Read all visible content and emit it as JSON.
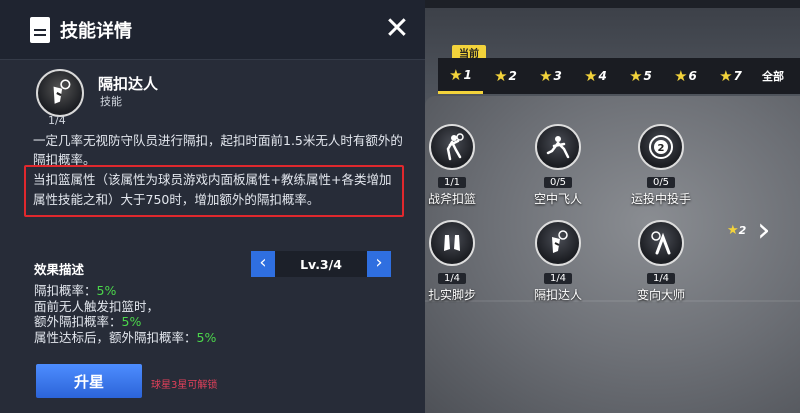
{
  "panel": {
    "title": "技能详情",
    "close_label": "✕",
    "skill": {
      "name": "隔扣达人",
      "type": "技能",
      "count": "1/4"
    },
    "description_1": "一定几率无视防守队员进行隔扣，起扣时面前1.5米无人时有额外的隔扣概率。",
    "description_2": "当扣篮属性（该属性为球员游戏内面板属性+教练属性+各类增加属性技能之和）大于750时，增加额外的隔扣概率。",
    "effect_label": "效果描述",
    "level": {
      "text": "Lv.3/4",
      "prev": "‹",
      "next": "›"
    },
    "effects": [
      {
        "label": "隔扣概率：",
        "value": "5%"
      },
      {
        "label": "面前无人触发扣篮时，",
        "value": ""
      },
      {
        "label": "额外隔扣概率：",
        "value": "5%"
      },
      {
        "label": "属性达标后，额外隔扣概率：",
        "value": "5%"
      }
    ],
    "upgrade_label": "升星",
    "unlock_hint": "球星3星可解锁"
  },
  "stars": {
    "current_badge": "当前",
    "tabs": [
      "1",
      "2",
      "3",
      "4",
      "5",
      "6",
      "7"
    ],
    "all_label": "全部",
    "active_index": 0
  },
  "skills_grid": [
    {
      "name": "战斧扣篮",
      "count": "1/1"
    },
    {
      "name": "空中飞人",
      "count": "0/5"
    },
    {
      "name": "运投中投手",
      "count": "0/5"
    },
    {
      "name": "扎实脚步",
      "count": "1/4"
    },
    {
      "name": "隔扣达人",
      "count": "1/4"
    },
    {
      "name": "变向大师",
      "count": "1/4"
    }
  ],
  "side_star_label": "2",
  "colors": {
    "accent_blue": "#2f6fe0",
    "star_yellow": "#f3d33b",
    "highlight_red": "#e0282d",
    "value_green": "#4bd64b"
  }
}
